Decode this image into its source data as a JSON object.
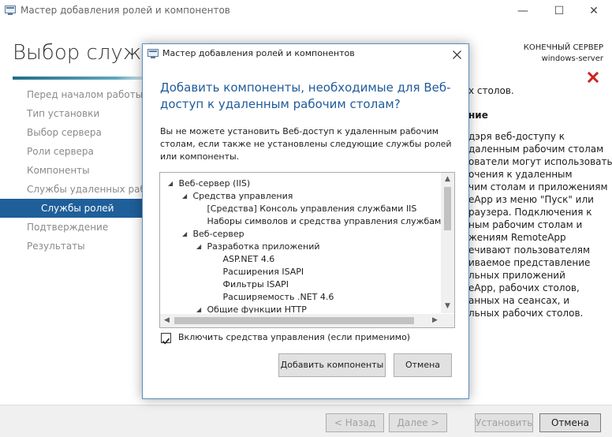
{
  "window": {
    "title": "Мастер добавления ролей и компонентов",
    "minimize_glyph": "—",
    "maximize_glyph": "☐",
    "close_glyph": "✕"
  },
  "main": {
    "heading": "Выбор служб ролей",
    "destination_label": "КОНЕЧНЫЙ СЕРВЕР",
    "destination_server": "windows-server",
    "nav_items": [
      {
        "label": "Перед началом работы",
        "active": false
      },
      {
        "label": "Тип установки",
        "active": false
      },
      {
        "label": "Выбор сервера",
        "active": false
      },
      {
        "label": "Роли сервера",
        "active": false
      },
      {
        "label": "Компоненты",
        "active": false
      },
      {
        "label": "Службы удаленных рабо...",
        "active": false
      },
      {
        "label": "Службы ролей",
        "active": true
      },
      {
        "label": "Подтверждение",
        "active": false
      },
      {
        "label": "Результаты",
        "active": false
      }
    ],
    "right_line1": "х столов.",
    "right_heading": "ние",
    "right_paragraph": [
      "дэря веб-доступу к",
      "даленным рабочим столам",
      "ователи могут использовать",
      "очения к удаленным",
      "чим столам и приложениям",
      "eApp из меню \"Пуск\" или",
      "раузера. Подключения к",
      "ным рабочим столам и",
      "жениям RemoteApp",
      "ечивают пользователям",
      "иваемое представление",
      "льных приложений",
      "eApp, рабочих столов,",
      "анных на сеансах, и",
      "льных рабочих столов."
    ]
  },
  "footer": {
    "back_label": "< Назад",
    "next_label": "Далее >",
    "install_label": "Установить",
    "cancel_label": "Отмена"
  },
  "dialog": {
    "title": "Мастер добавления ролей и компонентов",
    "question": "Добавить компоненты, необходимые для Веб-доступ к удаленным рабочим столам?",
    "message": "Вы не можете установить Веб-доступ к удаленным рабочим столам, если также не установлены следующие службы ролей или компоненты.",
    "tree": [
      {
        "label": "Веб-сервер (IIS)",
        "level": 0,
        "expanded": true
      },
      {
        "label": "Средства управления",
        "level": 1,
        "expanded": true
      },
      {
        "label": "[Средства] Консоль управления службами IIS",
        "level": 2,
        "expanded": null
      },
      {
        "label": "Наборы символов и средства управления службами",
        "level": 2,
        "expanded": null
      },
      {
        "label": "Веб-сервер",
        "level": 1,
        "expanded": true
      },
      {
        "label": "Разработка приложений",
        "level": 2,
        "expanded": true
      },
      {
        "label": "ASP.NET 4.6",
        "level": 3,
        "expanded": null
      },
      {
        "label": "Расширения ISAPI",
        "level": 3,
        "expanded": null
      },
      {
        "label": "Фильтры ISAPI",
        "level": 3,
        "expanded": null
      },
      {
        "label": "Расширяемость .NET 4.6",
        "level": 3,
        "expanded": null
      },
      {
        "label": "Общие функции HTTP",
        "level": 2,
        "expanded": true
      }
    ],
    "include_tools_label": "Включить средства управления (если применимо)",
    "include_tools_checked": true,
    "add_button": "Добавить компоненты",
    "cancel_button": "Отмена"
  }
}
